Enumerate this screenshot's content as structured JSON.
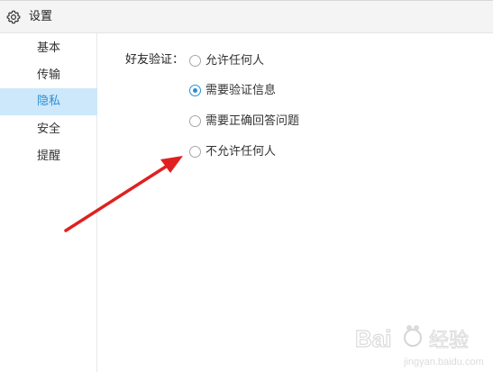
{
  "window": {
    "title": "设置",
    "title_icon": "gear-icon"
  },
  "sidebar": {
    "items": [
      {
        "label": "基本",
        "active": false
      },
      {
        "label": "传输",
        "active": false
      },
      {
        "label": "隐私",
        "active": true
      },
      {
        "label": "安全",
        "active": false
      },
      {
        "label": "提醒",
        "active": false
      }
    ]
  },
  "privacy": {
    "friend_verification": {
      "label": "好友验证：",
      "selected": "需要验证信息",
      "options": [
        {
          "label": "允许任何人",
          "checked": false
        },
        {
          "label": "需要验证信息",
          "checked": true
        },
        {
          "label": "需要正确回答问题",
          "checked": false
        },
        {
          "label": "不允许任何人",
          "checked": false
        }
      ]
    }
  },
  "annotation": {
    "arrow_color": "#e02020",
    "arrow_icon": "red-arrow-pointer"
  },
  "watermark": {
    "logo_icon": "baidu-jingyan-logo",
    "text": "Bai 经验",
    "url": "jingyan.baidu.com"
  },
  "colors": {
    "accent": "#2a8fd6",
    "active_bg": "#cde8fa",
    "titlebar_bg": "#f4f4f4"
  }
}
